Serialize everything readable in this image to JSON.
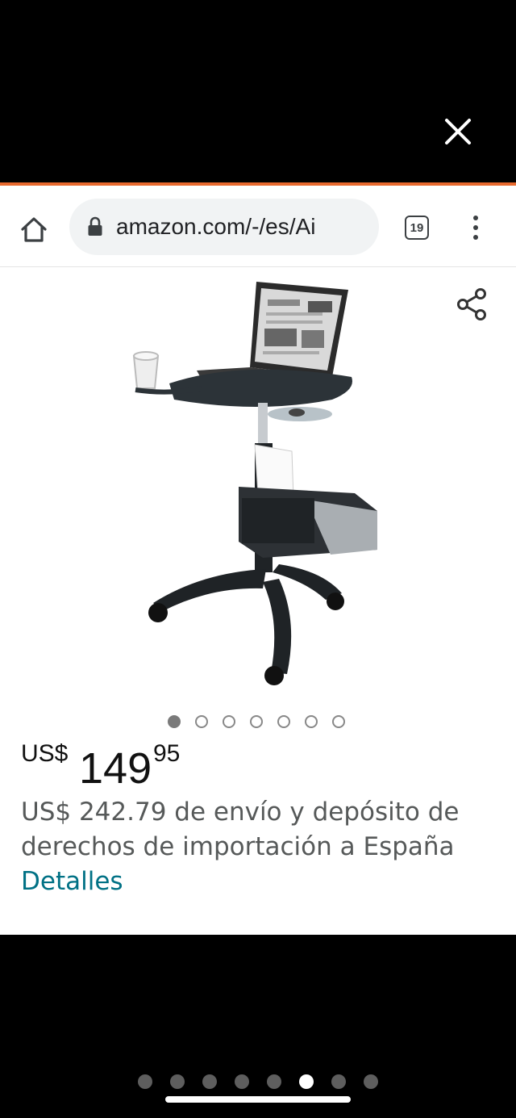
{
  "browser": {
    "url": "amazon.com/-/es/Ai",
    "tab_count": "19",
    "accent_color": "#e8692e"
  },
  "carousel": {
    "count": 7,
    "active_index": 0
  },
  "product": {
    "price_currency": "US$",
    "price_whole": "149",
    "price_fraction": "95",
    "shipping_text": "US$ 242.79 de envío y depósito de derechos de importación a España",
    "details_link": "Detalles"
  },
  "viewer": {
    "page_count": 8,
    "active_index": 5
  },
  "icons": {
    "close": "close-icon",
    "home": "home-icon",
    "lock": "lock-icon",
    "share": "share-icon",
    "menu": "more-vert-icon"
  }
}
